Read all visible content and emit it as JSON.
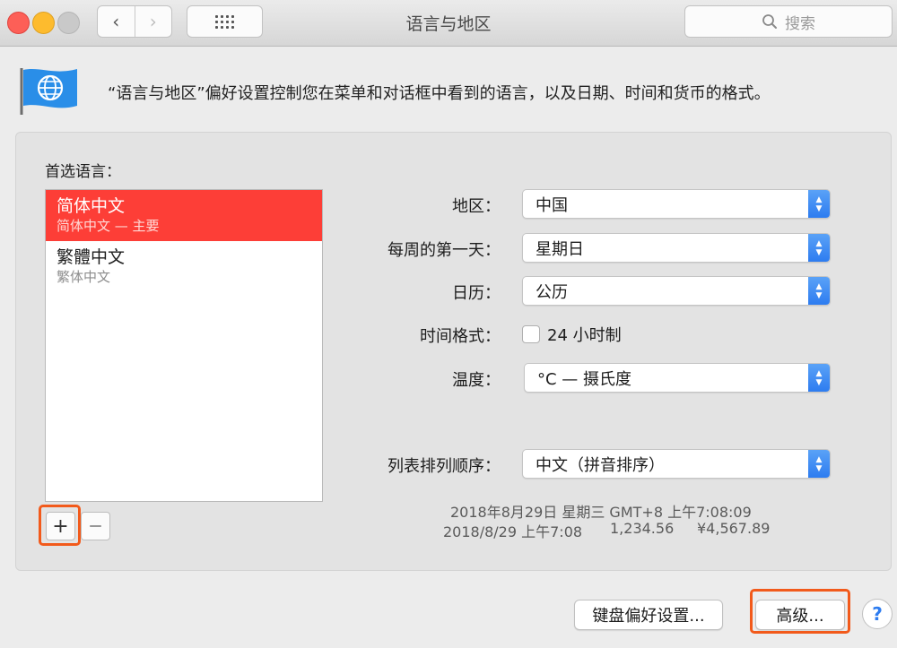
{
  "window": {
    "title": "语言与地区",
    "search_placeholder": "搜索",
    "back_glyph": "‹",
    "forward_glyph": "›"
  },
  "header": {
    "description": "“语言与地区”偏好设置控制您在菜单和对话框中看到的语言，以及日期、时间和货币的格式。",
    "icon": "globe-flag-icon"
  },
  "languages": {
    "label": "首选语言：",
    "items": [
      {
        "name": "简体中文",
        "sub": "简体中文 — 主要",
        "selected": true
      },
      {
        "name": "繁體中文",
        "sub": "繁体中文",
        "selected": false
      }
    ],
    "add_label": "+",
    "remove_label": "—"
  },
  "settings": {
    "region_label": "地区：",
    "region_value": "中国",
    "first_day_label": "每周的第一天：",
    "first_day_value": "星期日",
    "calendar_label": "日历：",
    "calendar_value": "公历",
    "time_format_label": "时间格式：",
    "time_format_option": "24 小时制",
    "time_format_checked": false,
    "temperature_label": "温度：",
    "temperature_value": "°C — 摄氏度",
    "sort_label": "列表排列顺序：",
    "sort_value": "中文（拼音排序）"
  },
  "samples": {
    "line1": "2018年8月29日 星期三 GMT+8 上午7:08:09",
    "line2_date": "2018/8/29 上午7:08",
    "line2_number": "1,234.56",
    "line2_currency": "¥4,567.89"
  },
  "footer": {
    "keyboard_button": "键盘偏好设置...",
    "advanced_button": "高级...",
    "help_button": "?"
  },
  "colors": {
    "accent": "#2d7cf0",
    "selection": "#fd3e37",
    "highlight_box": "#f25a1b"
  }
}
